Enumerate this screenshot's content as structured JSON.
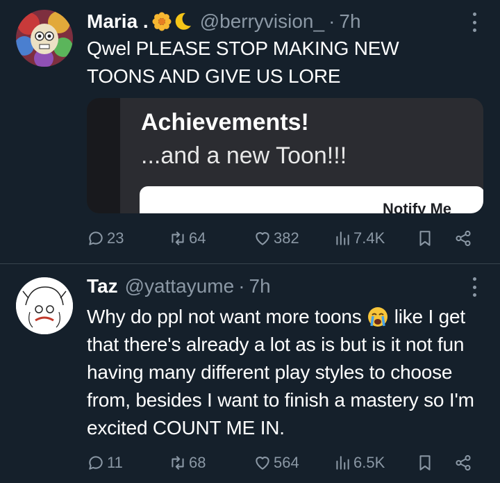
{
  "tweets": [
    {
      "name": "Maria .",
      "handle": "@berryvision_",
      "dot": "·",
      "time": "7h",
      "text": "Qwel PLEASE STOP MAKING NEW TOONS AND GIVE US LORE",
      "card": {
        "title": "Achievements!",
        "subtitle": "...and a new Toon!!!",
        "button": "Notify Me"
      },
      "actions": {
        "replies": "23",
        "retweets": "64",
        "likes": "382",
        "views": "7.4K"
      }
    },
    {
      "name": "Taz",
      "handle": "@yattayume",
      "dot": "·",
      "time": "7h",
      "text_before_emoji": "Why do ppl not want more toons",
      "text_after_emoji": " like I get that there's already a lot as is but is it not fun having many different play styles to choose from, besides I want to finish a mastery so I'm excited COUNT ME IN.",
      "actions": {
        "replies": "11",
        "retweets": "68",
        "likes": "564",
        "views": "6.5K"
      }
    }
  ],
  "icons": {
    "reply": "speech-bubble-icon",
    "retweet": "retweet-icon",
    "like": "heart-icon",
    "views": "bar-chart-icon",
    "bookmark": "bookmark-icon",
    "share": "share-icon"
  },
  "colors": {
    "background": "#15202b",
    "secondary_text": "#8b98a5",
    "divider": "#38444d"
  }
}
